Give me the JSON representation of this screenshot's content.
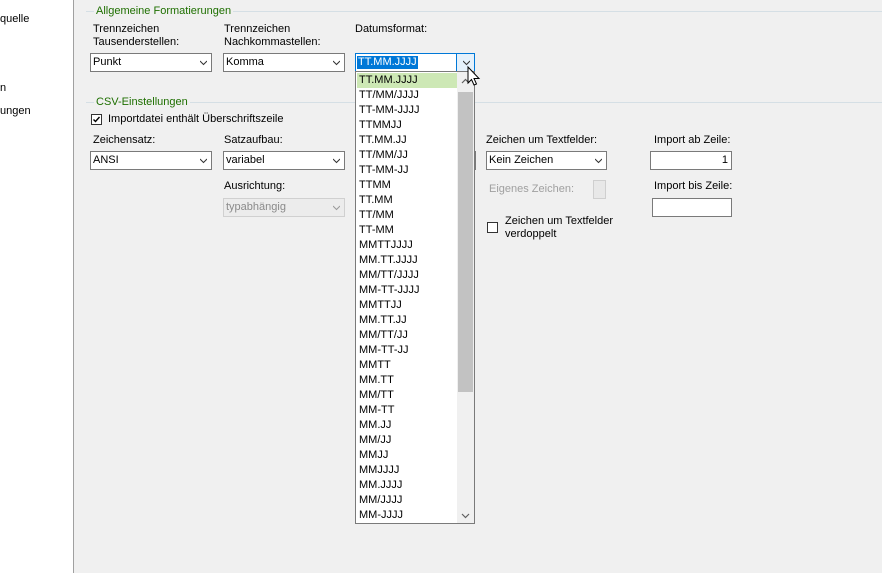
{
  "nav": {
    "items": [
      "quelle",
      "n",
      "ungen"
    ]
  },
  "general": {
    "title": "Allgemeine Formatierungen",
    "thousands_label": "Trennzeichen\nTausenderstellen:",
    "thousands_label_l1": "Trennzeichen",
    "thousands_label_l2": "Tausenderstellen:",
    "thousands_value": "Punkt",
    "decimal_label_l1": "Trennzeichen",
    "decimal_label_l2": "Nachkommastellen:",
    "decimal_value": "Komma",
    "date_label": "Datumsformat:",
    "date_value": "TT.MM.JJJJ"
  },
  "csv": {
    "title": "CSV-Einstellungen",
    "header_row_label": "Importdatei enthält Überschriftszeile",
    "header_row_checked": true,
    "charset_label": "Zeichensatz:",
    "charset_value": "ANSI",
    "record_label": "Satzaufbau:",
    "record_value": "variabel",
    "alignment_label": "Ausrichtung:",
    "alignment_value": "typabhängig",
    "text_char_label": "Zeichen um Textfelder:",
    "text_char_value": "Kein Zeichen",
    "own_char_label": "Eigenes Zeichen:",
    "double_label_l1": "Zeichen um Textfelder",
    "double_label_l2": "verdoppelt",
    "double_checked": false,
    "import_from_label": "Import ab Zeile:",
    "import_from_value": "1",
    "import_to_label": "Import bis Zeile:",
    "import_to_value": ""
  },
  "date_dropdown": {
    "selected_index": 0,
    "options": [
      "TT.MM.JJJJ",
      "TT/MM/JJJJ",
      "TT-MM-JJJJ",
      "TTMMJJ",
      "TT.MM.JJ",
      "TT/MM/JJ",
      "TT-MM-JJ",
      "TTMM",
      "TT.MM",
      "TT/MM",
      "TT-MM",
      "MMTTJJJJ",
      "MM.TT.JJJJ",
      "MM/TT/JJJJ",
      "MM-TT-JJJJ",
      "MMTTJJ",
      "MM.TT.JJ",
      "MM/TT/JJ",
      "MM-TT-JJ",
      "MMTT",
      "MM.TT",
      "MM/TT",
      "MM-TT",
      "MM.JJ",
      "MM/JJ",
      "MMJJ",
      "MMJJJJ",
      "MM.JJJJ",
      "MM/JJJJ",
      "MM-JJJJ"
    ]
  },
  "colors": {
    "group_title": "#1e6f00",
    "selection": "#0078d7",
    "list_highlight": "#cde8b5"
  },
  "icons": {
    "combo_arrow": "chevron-down-icon",
    "checkmark": "checkmark-icon",
    "cursor": "mouse-pointer-icon"
  }
}
